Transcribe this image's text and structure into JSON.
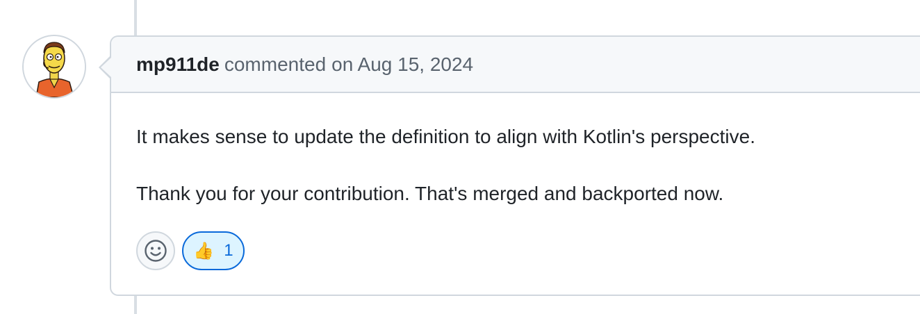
{
  "comment": {
    "author": "mp911de",
    "action": "commented",
    "timestamp": "on Aug 15, 2024",
    "paragraphs": [
      "It makes sense to update the definition to align with Kotlin's perspective.",
      "Thank you for your contribution. That's merged and backported now."
    ]
  },
  "reactions": {
    "add_icon": "smiley-icon",
    "items": [
      {
        "emoji": "👍",
        "icon": "thumbs-up-icon",
        "count": "1"
      }
    ]
  },
  "colors": {
    "border": "#d0d7de",
    "header_bg": "#f6f8fa",
    "muted_text": "#59636e",
    "accent_blue": "#0969da",
    "reaction_bg": "#ddf4ff"
  }
}
